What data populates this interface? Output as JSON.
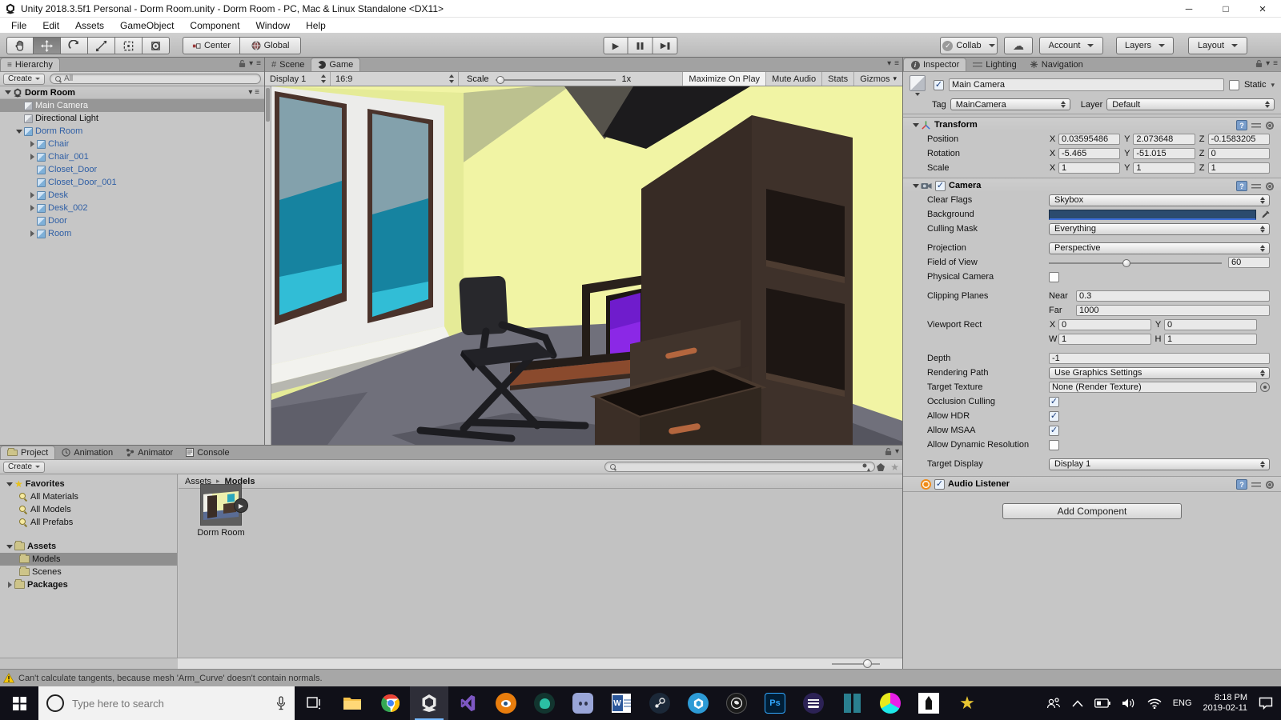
{
  "colors": {
    "taskbar_accent": "#76b9ff",
    "prefab_text_blue": "#2f5fa5",
    "camera_background_swatch": "#2b4b6e",
    "warning_yellow": "#f7c808",
    "selection_gray": "#969696"
  },
  "icons": {
    "play": "▶",
    "check": "✓",
    "cloud": "☁",
    "star": "★",
    "menu": "≡",
    "dropdown": "▾",
    "hash": "#",
    "minimize": "─",
    "maximize": "□",
    "close": "×",
    "crumb_sep": "▸"
  },
  "window": {
    "title": "Unity 2018.3.5f1 Personal - Dorm Room.unity - Dorm Room - PC, Mac & Linux Standalone <DX11>",
    "menus": [
      "File",
      "Edit",
      "Assets",
      "GameObject",
      "Component",
      "Window",
      "Help"
    ]
  },
  "toolbar": {
    "center": "Center",
    "global": "Global",
    "collab": "Collab",
    "account": "Account",
    "layers": "Layers",
    "layout": "Layout"
  },
  "hierarchy": {
    "tab": "Hierarchy",
    "create": "Create",
    "search_filter": "All",
    "scene": "Dorm Room",
    "items": [
      "Main Camera",
      "Directional Light",
      "Dorm Room",
      "Chair",
      "Chair_001",
      "Closet_Door",
      "Closet_Door_001",
      "Desk",
      "Desk_002",
      "Door",
      "Room"
    ]
  },
  "game": {
    "scene_tab": "Scene",
    "game_tab": "Game",
    "display": "Display 1",
    "aspect": "16:9",
    "scale_label": "Scale",
    "scale_value": "1x",
    "maximize": "Maximize On Play",
    "mute": "Mute Audio",
    "stats": "Stats",
    "gizmos": "Gizmos"
  },
  "inspector": {
    "tabs": {
      "inspector": "Inspector",
      "lighting": "Lighting",
      "navigation": "Navigation"
    },
    "header": {
      "name": "Main Camera",
      "static": "Static",
      "tag_label": "Tag",
      "tag": "MainCamera",
      "layer_label": "Layer",
      "layer": "Default"
    },
    "axes": [
      "X",
      "Y",
      "Z"
    ],
    "transform": {
      "title": "Transform",
      "rows": [
        {
          "label": "Position",
          "x": "0.03595486",
          "y": "2.073648",
          "z": "-0.1583205"
        },
        {
          "label": "Rotation",
          "x": "-5.465",
          "y": "-51.015",
          "z": "0"
        },
        {
          "label": "Scale",
          "x": "1",
          "y": "1",
          "z": "1"
        }
      ]
    },
    "camera": {
      "title": "Camera",
      "clear_flags_label": "Clear Flags",
      "clear_flags": "Skybox",
      "background_label": "Background",
      "culling_mask_label": "Culling Mask",
      "culling_mask": "Everything",
      "projection_label": "Projection",
      "projection": "Perspective",
      "fov_label": "Field of View",
      "fov": "60",
      "physical_label": "Physical Camera",
      "clipping_label": "Clipping Planes",
      "near_label": "Near",
      "near": "0.3",
      "far_label": "Far",
      "far": "1000",
      "viewport_label": "Viewport Rect",
      "x_label": "X",
      "y_label": "Y",
      "w_label": "W",
      "h_label": "H",
      "vx": "0",
      "vy": "0",
      "vw": "1",
      "vh": "1",
      "depth_label": "Depth",
      "depth": "-1",
      "rendering_path_label": "Rendering Path",
      "rendering_path": "Use Graphics Settings",
      "target_texture_label": "Target Texture",
      "target_texture": "None (Render Texture)",
      "occlusion_label": "Occlusion Culling",
      "hdr_label": "Allow HDR",
      "msaa_label": "Allow MSAA",
      "dynamic_label": "Allow Dynamic Resolution",
      "target_display_label": "Target Display",
      "target_display": "Display 1"
    },
    "audio_listener": "Audio Listener",
    "add_component": "Add Component"
  },
  "project": {
    "tabs": [
      "Project",
      "Animation",
      "Animator",
      "Console"
    ],
    "create": "Create",
    "favorites_label": "Favorites",
    "favorites": [
      "All Materials",
      "All Models",
      "All Prefabs"
    ],
    "assets_label": "Assets",
    "folders": [
      "Models",
      "Scenes"
    ],
    "packages_label": "Packages",
    "breadcrumb": {
      "root": "Assets",
      "current": "Models"
    },
    "item": "Dorm Room"
  },
  "status": {
    "warning": "Can't calculate tangents, because mesh 'Arm_Curve' doesn't contain normals."
  },
  "taskbar": {
    "search_placeholder": "Type here to search",
    "tray": {
      "lang": "ENG",
      "time": "8:18 PM",
      "date": "2019-02-11"
    }
  }
}
